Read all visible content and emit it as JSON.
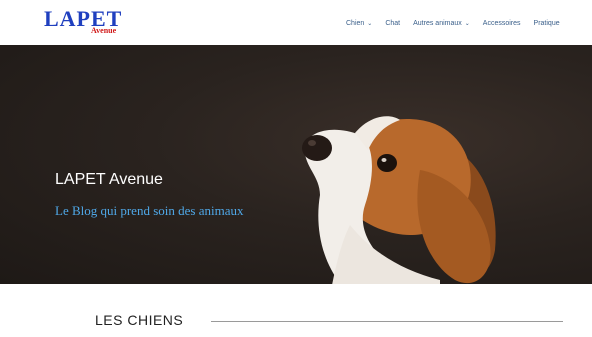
{
  "logo": {
    "main": "LAPET",
    "sub": "Avenue"
  },
  "nav": {
    "items": [
      {
        "label": "Chien",
        "has_dropdown": true
      },
      {
        "label": "Chat",
        "has_dropdown": false
      },
      {
        "label": "Autres animaux",
        "has_dropdown": true
      },
      {
        "label": "Accessoires",
        "has_dropdown": false
      },
      {
        "label": "Pratique",
        "has_dropdown": false
      }
    ],
    "chevron_icon": "chevron-down-icon"
  },
  "hero": {
    "title": "LAPET Avenue",
    "subtitle": "Le Blog qui prend soin des animaux"
  },
  "section": {
    "title": "LES CHIENS"
  },
  "colors": {
    "logo_blue": "#1f3fbf",
    "logo_red": "#d11a1a",
    "nav_text": "#3a5f8a",
    "hero_subtitle": "#4fa8e8"
  }
}
